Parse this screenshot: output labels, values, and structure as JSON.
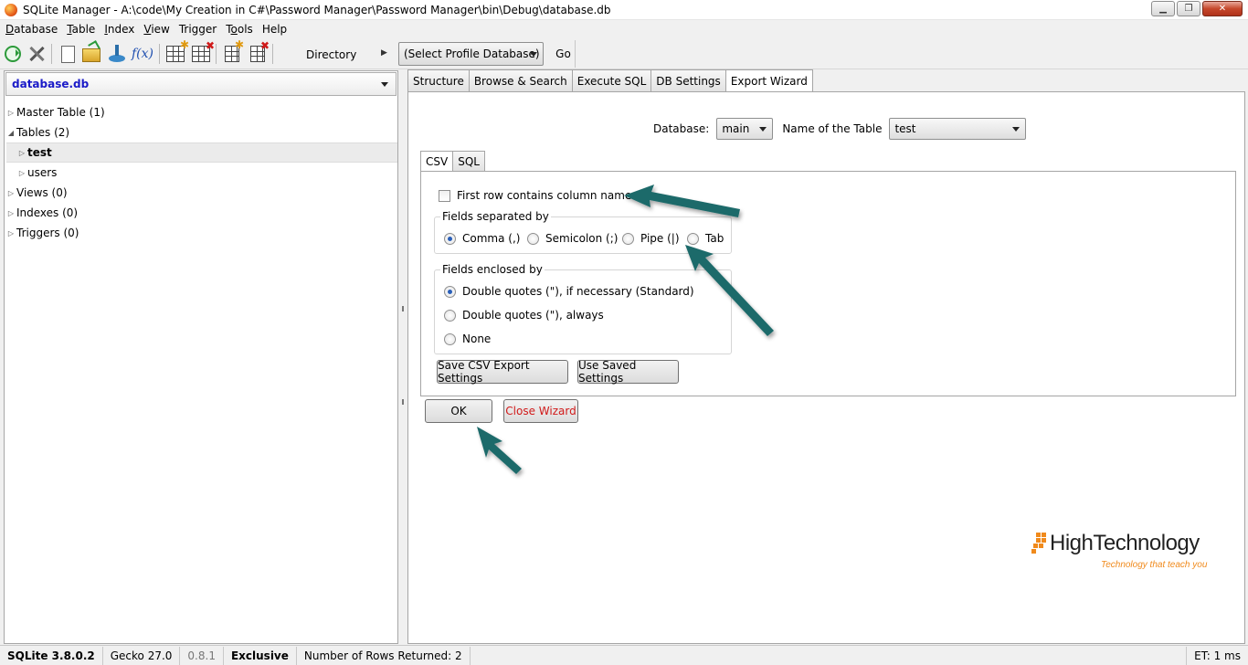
{
  "window": {
    "title": "SQLite Manager - A:\\code\\My Creation in C#\\Password Manager\\Password Manager\\bin\\Debug\\database.db",
    "minimize": "▁",
    "maximize": "❐",
    "close": "✕"
  },
  "menu": [
    {
      "pre": "",
      "u": "D",
      "post": "atabase"
    },
    {
      "pre": "",
      "u": "T",
      "post": "able"
    },
    {
      "pre": "",
      "u": "I",
      "post": "ndex"
    },
    {
      "pre": "",
      "u": "V",
      "post": "iew"
    },
    {
      "pre": "",
      "u": "",
      "post": "Trigger"
    },
    {
      "pre": "T",
      "u": "o",
      "post": "ols"
    },
    {
      "pre": "",
      "u": "",
      "post": "Help"
    }
  ],
  "toolbar": {
    "fx_label": "f(x)",
    "directory_label": "Directory",
    "directory_arrow": "▶",
    "profile_select": "(Select Profile Database)",
    "go_label": "Go"
  },
  "sidebar": {
    "database": "database.db",
    "tree": [
      {
        "label": "Master Table (1)",
        "level": 0,
        "expanded": false
      },
      {
        "label": "Tables (2)",
        "level": 0,
        "expanded": true
      },
      {
        "label": "test",
        "level": 1,
        "expanded": false,
        "selected": true
      },
      {
        "label": "users",
        "level": 1,
        "expanded": false
      },
      {
        "label": "Views (0)",
        "level": 0,
        "expanded": false
      },
      {
        "label": "Indexes (0)",
        "level": 0,
        "expanded": false
      },
      {
        "label": "Triggers (0)",
        "level": 0,
        "expanded": false
      }
    ]
  },
  "tabs": [
    "Structure",
    "Browse & Search",
    "Execute SQL",
    "DB Settings",
    "Export Wizard"
  ],
  "active_tab": "Export Wizard",
  "export": {
    "database_label": "Database:",
    "database_value": "main",
    "table_label": "Name of the Table",
    "table_value": "test",
    "subtabs": [
      "CSV",
      "SQL"
    ],
    "first_row_label": "First row contains column names",
    "separated_label": "Fields separated by",
    "separators": [
      "Comma (,)",
      "Semicolon (;)",
      "Pipe (|)",
      "Tab"
    ],
    "enclosed_label": "Fields enclosed by",
    "enclosures": [
      "Double quotes (\"), if necessary (Standard)",
      "Double quotes (\"), always",
      "None"
    ],
    "save_settings": "Save CSV Export Settings",
    "use_saved": "Use Saved Settings",
    "ok": "OK",
    "close_wizard": "Close Wizard"
  },
  "logo": {
    "brand": "HighTechnology",
    "tagline": "Technology that teach you",
    "brand_color": "#f08a1c"
  },
  "status": {
    "sqlite": "SQLite 3.8.0.2",
    "gecko": "Gecko 27.0",
    "version": "0.8.1",
    "mode": "Exclusive",
    "rows": "Number of Rows Returned: 2",
    "et": "ET: 1 ms"
  },
  "colors": {
    "accent_arrow": "#1f6b6b",
    "db_name": "#1a1ac8",
    "close_wizard": "#d11a1a"
  }
}
